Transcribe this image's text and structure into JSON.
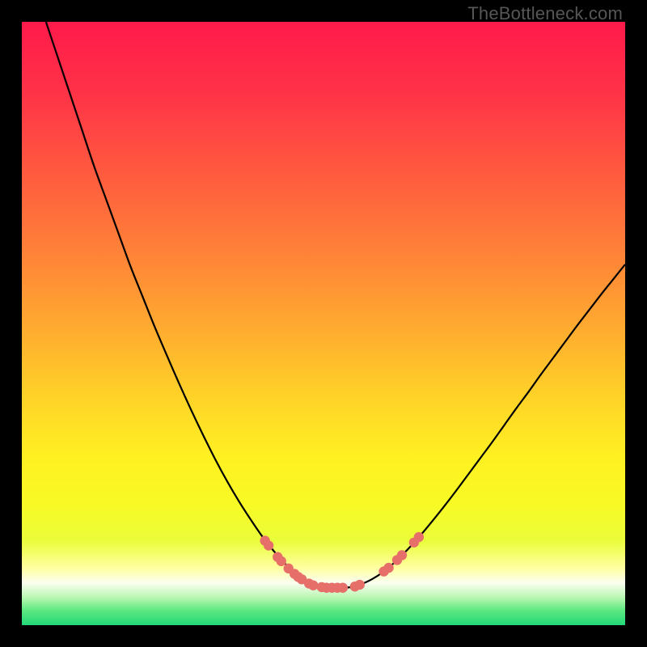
{
  "watermark": "TheBottleneck.com",
  "colors": {
    "frame": "#000000",
    "curve": "#000000",
    "marker": "#e76f6a",
    "gradient_stops": [
      {
        "offset": 0.0,
        "color": "#ff1a4a"
      },
      {
        "offset": 0.12,
        "color": "#ff3347"
      },
      {
        "offset": 0.25,
        "color": "#ff5a3f"
      },
      {
        "offset": 0.38,
        "color": "#ff8138"
      },
      {
        "offset": 0.5,
        "color": "#ffa830"
      },
      {
        "offset": 0.62,
        "color": "#ffd228"
      },
      {
        "offset": 0.72,
        "color": "#fff022"
      },
      {
        "offset": 0.8,
        "color": "#f8fa25"
      },
      {
        "offset": 0.86,
        "color": "#eafd3a"
      },
      {
        "offset": 0.905,
        "color": "#ffffa0"
      },
      {
        "offset": 0.93,
        "color": "#fafef0"
      },
      {
        "offset": 0.955,
        "color": "#b7f7b0"
      },
      {
        "offset": 0.975,
        "color": "#5fe882"
      },
      {
        "offset": 1.0,
        "color": "#22d877"
      }
    ]
  },
  "chart_data": {
    "type": "line",
    "title": "",
    "xlabel": "",
    "ylabel": "",
    "xlim": [
      0,
      100
    ],
    "ylim": [
      0,
      100
    ],
    "series": [
      {
        "name": "left-curve",
        "x": [
          4,
          6,
          8,
          10,
          12,
          14,
          16,
          18,
          20,
          22,
          24,
          26,
          28,
          30,
          32,
          34,
          36,
          38,
          40,
          42,
          44,
          45.5,
          47,
          48.5,
          50,
          51.5
        ],
        "y": [
          100,
          94,
          88,
          82,
          76,
          70.5,
          65,
          59.5,
          54.5,
          49.5,
          44.8,
          40.2,
          35.8,
          31.6,
          27.6,
          23.9,
          20.5,
          17.4,
          14.5,
          12,
          9.8,
          8.3,
          7.2,
          6.5,
          6.2,
          6.2
        ]
      },
      {
        "name": "right-curve",
        "x": [
          51.5,
          53,
          54.5,
          56,
          58,
          60,
          62,
          64,
          66,
          68,
          70,
          72,
          74,
          76,
          78,
          80,
          82,
          84,
          86,
          88,
          90,
          92,
          94,
          96,
          98,
          100
        ],
        "y": [
          6.2,
          6.2,
          6.3,
          6.7,
          7.6,
          8.9,
          10.6,
          12.6,
          14.8,
          17.2,
          19.7,
          22.3,
          25.0,
          27.7,
          30.4,
          33.2,
          36.0,
          38.7,
          41.5,
          44.2,
          46.9,
          49.6,
          52.2,
          54.8,
          57.3,
          59.8
        ]
      }
    ],
    "markers_left": [
      {
        "x": 40.3,
        "y": 14.0
      },
      {
        "x": 40.9,
        "y": 13.2
      },
      {
        "x": 42.4,
        "y": 11.3
      },
      {
        "x": 43.0,
        "y": 10.6
      },
      {
        "x": 44.2,
        "y": 9.4
      },
      {
        "x": 45.2,
        "y": 8.5
      },
      {
        "x": 45.8,
        "y": 8.0
      },
      {
        "x": 46.4,
        "y": 7.6
      },
      {
        "x": 47.6,
        "y": 6.9
      },
      {
        "x": 48.3,
        "y": 6.6
      },
      {
        "x": 49.7,
        "y": 6.3
      },
      {
        "x": 50.5,
        "y": 6.2
      },
      {
        "x": 51.4,
        "y": 6.2
      },
      {
        "x": 52.3,
        "y": 6.2
      },
      {
        "x": 53.2,
        "y": 6.2
      }
    ],
    "markers_right": [
      {
        "x": 55.2,
        "y": 6.4
      },
      {
        "x": 56.0,
        "y": 6.7
      },
      {
        "x": 60.0,
        "y": 8.9
      },
      {
        "x": 60.8,
        "y": 9.5
      },
      {
        "x": 62.2,
        "y": 10.8
      },
      {
        "x": 63.0,
        "y": 11.6
      },
      {
        "x": 65.0,
        "y": 13.7
      },
      {
        "x": 65.8,
        "y": 14.6
      }
    ]
  }
}
